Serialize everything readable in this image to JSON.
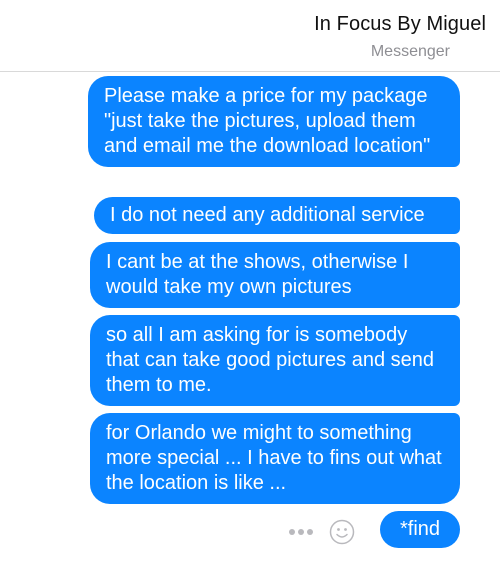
{
  "header": {
    "title": "In Focus By Miguel",
    "subtitle": "Messenger"
  },
  "messages": [
    "Please make a price for my package \"just take the pictures,  upload them and email me the download location\"",
    "I do not need any additional service",
    "I cant be at the shows, otherwise I would take my own pictures",
    "so all I am asking for is somebody that can take good pictures and send them to me.",
    "for Orlando we might to something more special ... I have to fins out what the location is like ...",
    "*find"
  ],
  "composer": {
    "more_icon": "ellipsis-icon",
    "emoji_icon": "smiley-icon"
  },
  "colors": {
    "bubble": "#0b84ff",
    "bubble_text": "#ffffff",
    "secondary_text": "#8e8e93"
  }
}
